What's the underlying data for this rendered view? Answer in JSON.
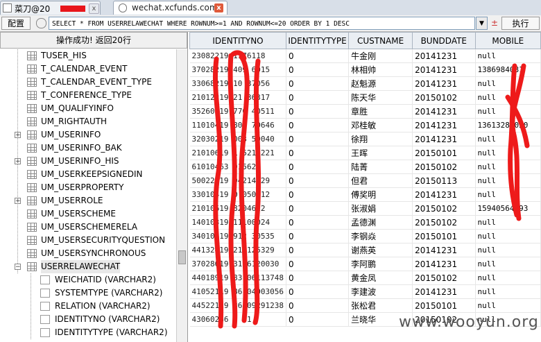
{
  "tabs": [
    {
      "label": "菜刀@20",
      "icon": "app-icon",
      "close_glyph": "x"
    },
    {
      "label": "wechat.xcfunds.com",
      "icon": "page-icon",
      "close_glyph": "x"
    }
  ],
  "toolbar": {
    "config_label": "配置",
    "sql_value": "SELECT * FROM USERRELAWECHAT WHERE ROWNUM>=1 AND ROWNUM<=20 ORDER BY 1 DESC",
    "dropdown_glyph": "▼",
    "pm_glyph": "±",
    "execute_label": "执行"
  },
  "status_message": "操作成功! 返回20行",
  "tree": {
    "tables": [
      {
        "name": "TUSER_HIS",
        "expandable": false
      },
      {
        "name": "T_CALENDAR_EVENT",
        "expandable": false
      },
      {
        "name": "T_CALENDAR_EVENT_TYPE",
        "expandable": false
      },
      {
        "name": "T_CONFERENCE_TYPE",
        "expandable": false
      },
      {
        "name": "UM_QUALIFYINFO",
        "expandable": false
      },
      {
        "name": "UM_RIGHTAUTH",
        "expandable": false
      },
      {
        "name": "UM_USERINFO",
        "expandable": true
      },
      {
        "name": "UM_USERINFO_BAK",
        "expandable": false
      },
      {
        "name": "UM_USERINFO_HIS",
        "expandable": true
      },
      {
        "name": "UM_USERKEEPSIGNEDIN",
        "expandable": false
      },
      {
        "name": "UM_USERPROPERTY",
        "expandable": false
      },
      {
        "name": "UM_USERROLE",
        "expandable": true
      },
      {
        "name": "UM_USERSCHEME",
        "expandable": false
      },
      {
        "name": "UM_USERSCHEMERELA",
        "expandable": false
      },
      {
        "name": "UM_USERSECURITYQUESTION",
        "expandable": false
      },
      {
        "name": "UM_USERSYNCHRONOUS",
        "expandable": false
      },
      {
        "name": "USERRELAWECHAT",
        "expandable": true,
        "expanded": true,
        "selected": true
      }
    ],
    "columns": [
      "WEICHATID (VARCHAR2)",
      "SYSTEMTYPE (VARCHAR2)",
      "RELATION (VARCHAR2)",
      "IDENTITYNO (VARCHAR2)",
      "IDENTITYTYPE (VARCHAR2)"
    ]
  },
  "grid": {
    "headers": [
      "IDENTITYNO",
      "IDENTITYTYPE",
      "CUSTNAME",
      "BUNDDATE",
      "MOBILE"
    ],
    "rows": [
      [
        "23082219   1176118",
        "0",
        "牛金刚",
        "20141231",
        "null"
      ],
      [
        "37028219   409   6015",
        "0",
        "林相帅",
        "20141231",
        "1386984081"
      ],
      [
        "33068219   10   37056",
        "0",
        "赵魁源",
        "20141231",
        "null"
      ],
      [
        "21012219   21   36317",
        "0",
        "陈天华",
        "20150102",
        "null"
      ],
      [
        "35260219   770   40511",
        "0",
        "章胜",
        "20141231",
        "null"
      ],
      [
        "11010419   806   70646",
        "0",
        "邓桂敏",
        "20141231",
        "13613287020"
      ],
      [
        "32030219   003   50040",
        "0",
        "徐翔",
        "20141231",
        "null"
      ],
      [
        "21010619   1   5211221",
        "0",
        "王晖",
        "20150101",
        "null"
      ],
      [
        "61010463   915626",
        "0",
        "陆菁",
        "20150102",
        "null"
      ],
      [
        "50022119   04214029",
        "0",
        "但君",
        "20150113",
        "null"
      ],
      [
        "33010419   0   050712",
        "0",
        "傅奖明",
        "20141231",
        "null"
      ],
      [
        "21010619   8204622",
        "0",
        "张淑娟",
        "20150102",
        "15940564193"
      ],
      [
        "14010319   11100024",
        "0",
        "孟德渊",
        "20150102",
        "null"
      ],
      [
        "34010419   912   30535",
        "0",
        "李钢焱",
        "20150101",
        "null"
      ],
      [
        "44132419   211125329",
        "0",
        "谢燕英",
        "20141231",
        "null"
      ],
      [
        "37028619   3106120030",
        "0",
        "李阿鹏",
        "20141231",
        "null"
      ],
      [
        "44018919   83   06113748",
        "0",
        "黄金凤",
        "20150102",
        "null"
      ],
      [
        "41052119   86   04003056",
        "0",
        "李建波",
        "20141231",
        "null"
      ],
      [
        "44522119   86   09291238",
        "0",
        "张松君",
        "20150101",
        "null"
      ],
      [
        "43060266   0   51",
        "0",
        "兰晓华",
        "20150102",
        "null"
      ]
    ]
  },
  "watermark": "www.wooyun.org",
  "colors": {
    "redaction": "#e8161b",
    "tab_close_active": "#e05a3a"
  }
}
